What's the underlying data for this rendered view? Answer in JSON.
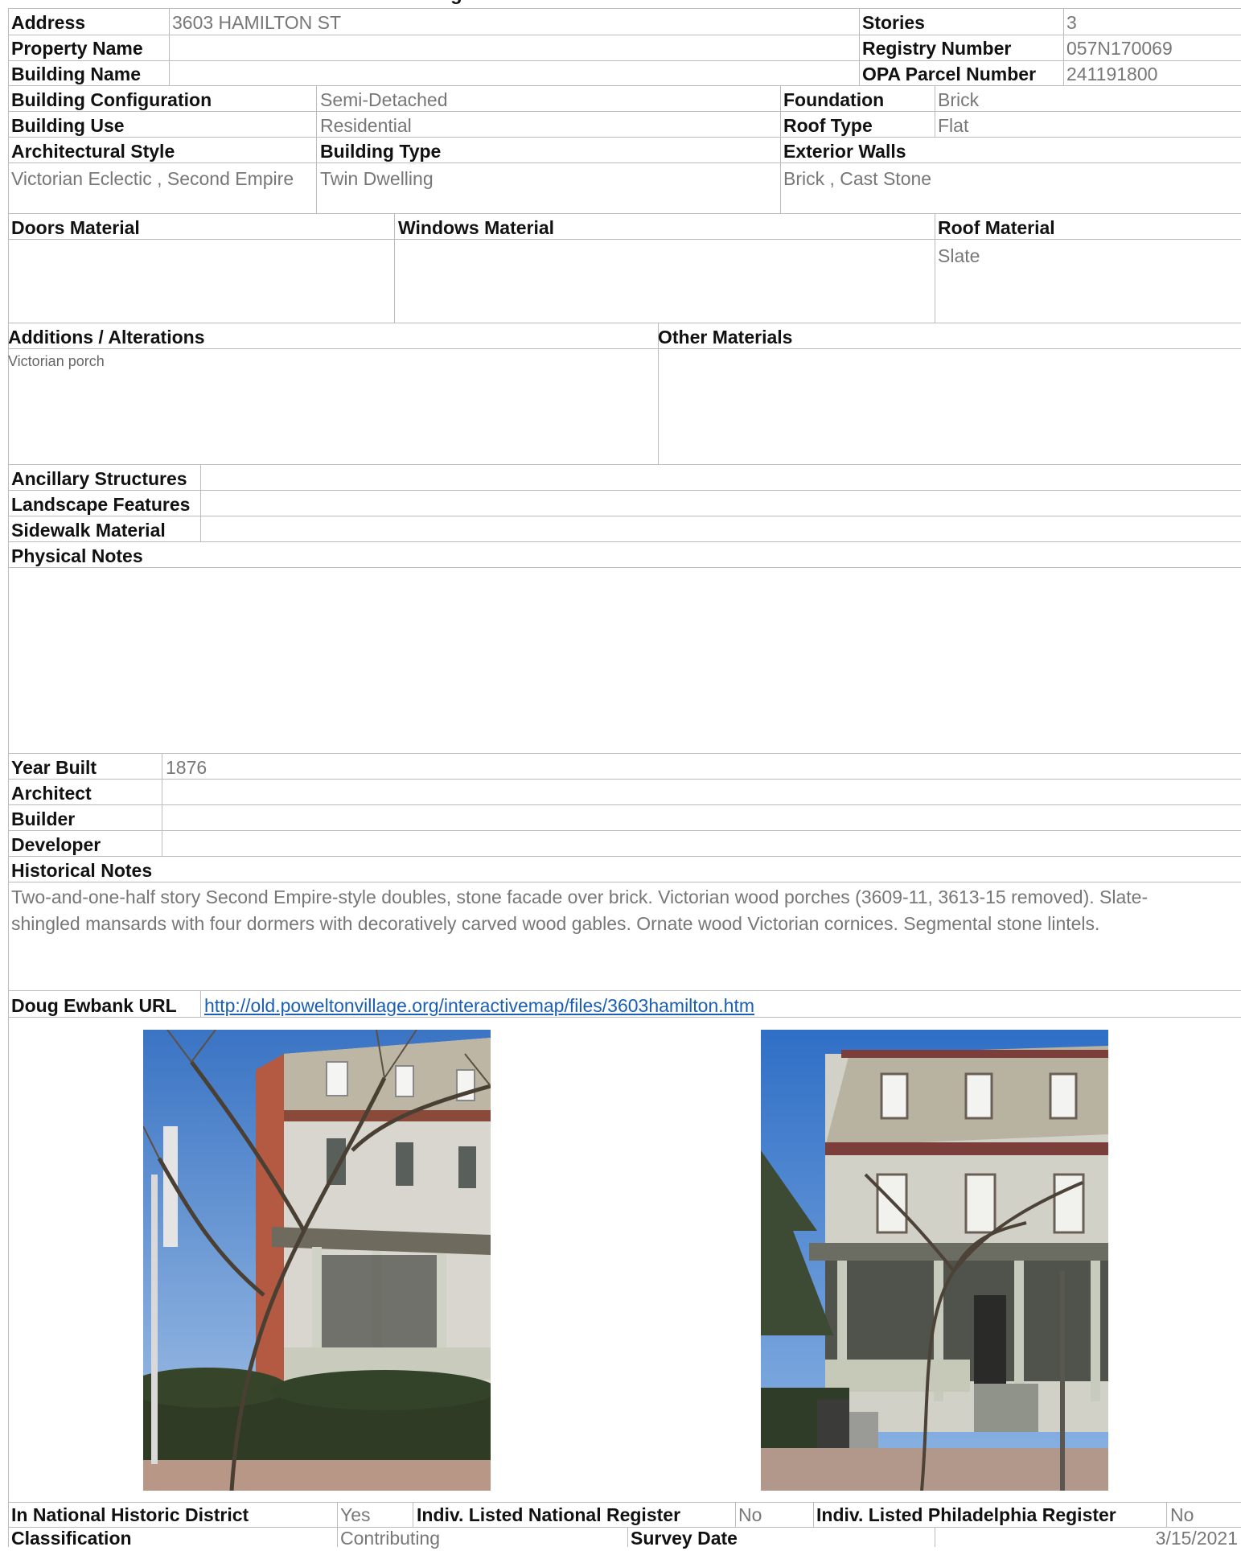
{
  "header": {
    "title_fragment": "g"
  },
  "property": {
    "address_label": "Address",
    "address_value": "3603 HAMILTON ST",
    "property_name_label": "Property Name",
    "property_name_value": "",
    "building_name_label": "Building Name",
    "building_name_value": "",
    "stories_label": "Stories",
    "stories_value": "3",
    "registry_label": "Registry Number",
    "registry_value": "057N170069",
    "opa_label": "OPA Parcel Number",
    "opa_value": "241191800"
  },
  "building": {
    "configuration_label": "Building Configuration",
    "configuration_value": "Semi-Detached",
    "use_label": "Building Use",
    "use_value": "Residential",
    "foundation_label": "Foundation",
    "foundation_value": "Brick",
    "roof_type_label": "Roof Type",
    "roof_type_value": "Flat",
    "arch_style_label": "Architectural Style",
    "arch_style_value": "Victorian Eclectic , Second Empire",
    "building_type_label": "Building Type",
    "building_type_value": "Twin Dwelling",
    "exterior_walls_label": "Exterior Walls",
    "exterior_walls_value": "Brick , Cast Stone"
  },
  "materials": {
    "doors_label": "Doors Material",
    "doors_value": "",
    "windows_label": "Windows Material",
    "windows_value": "",
    "roof_label": "Roof Material",
    "roof_value": "Slate",
    "additions_label": "Additions / Alterations",
    "additions_value": "Victorian porch",
    "other_label": "Other Materials",
    "other_value": ""
  },
  "site": {
    "ancillary_label": "Ancillary Structures",
    "landscape_label": "Landscape Features",
    "sidewalk_label": "Sidewalk Material",
    "physical_notes_label": "Physical Notes"
  },
  "history": {
    "year_built_label": "Year Built",
    "year_built_value": "1876",
    "architect_label": "Architect",
    "builder_label": "Builder",
    "developer_label": "Developer",
    "notes_label": "Historical Notes",
    "notes_line1": "Two-and-one-half story Second Empire-style doubles, stone facade over brick. Victorian wood porches (3609-11, 3613-15 removed). Slate-",
    "notes_line2": "shingled mansards with four dormers with decoratively carved wood gables. Ornate wood Victorian cornices. Segmental stone lintels."
  },
  "ewbank": {
    "label": "Doug Ewbank URL",
    "url": "http://old.poweltonvillage.org/interactivemap/files/3603hamilton.htm"
  },
  "status": {
    "national_district_label": "In National Historic District",
    "national_district_value": "Yes",
    "national_register_label": "Indiv. Listed National Register",
    "national_register_value": "No",
    "phila_register_label": "Indiv. Listed Philadelphia Register",
    "phila_register_value": "No",
    "classification_label": "Classification",
    "classification_value": "Contributing",
    "survey_date_label": "Survey Date",
    "survey_date_value": "3/15/2021"
  },
  "colors": {
    "link": "#1a5fb4",
    "grid": "#bcbcbc",
    "label": "#111111",
    "value": "#777777"
  }
}
